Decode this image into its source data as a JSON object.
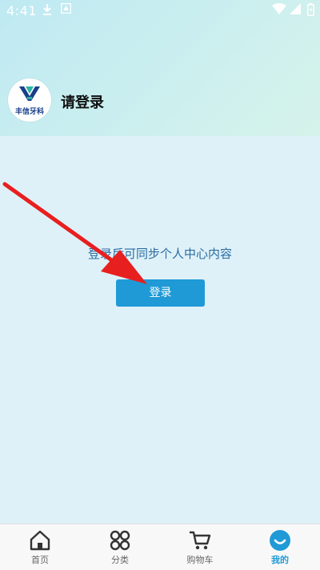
{
  "status_bar": {
    "time": "4:41",
    "icons": [
      "download-icon",
      "notification-app-icon",
      "wifi-icon",
      "signal-icon",
      "battery-icon"
    ]
  },
  "profile": {
    "logo_text": "丰信牙科",
    "title": "请登录"
  },
  "login_prompt": {
    "tip": "登录后可同步个人中心内容",
    "button_label": "登录"
  },
  "tabs": [
    {
      "label": "首页",
      "icon": "home-icon",
      "active": false
    },
    {
      "label": "分类",
      "icon": "category-icon",
      "active": false
    },
    {
      "label": "购物车",
      "icon": "cart-icon",
      "active": false
    },
    {
      "label": "我的",
      "icon": "profile-smile-icon",
      "active": true
    }
  ],
  "colors": {
    "accent": "#1f9ad6",
    "annotation_arrow": "#e81f1f",
    "tip_text": "#2a6ca3"
  }
}
